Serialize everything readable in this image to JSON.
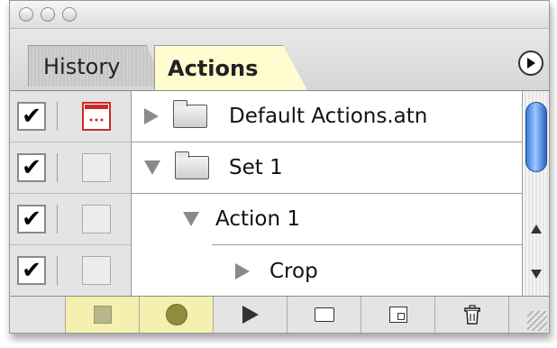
{
  "window": {
    "tabs": [
      {
        "label": "History",
        "active": false
      },
      {
        "label": "Actions",
        "active": true
      }
    ],
    "colors": {
      "active_tab": "#fffccf",
      "scroll_thumb": "#3a78d8",
      "record_button": "#f5efb0"
    }
  },
  "rows": [
    {
      "label": "Default Actions.atn",
      "checked": true,
      "dialog": true,
      "expanded": false,
      "type": "set"
    },
    {
      "label": "Set 1",
      "checked": true,
      "dialog": false,
      "expanded": true,
      "type": "set"
    },
    {
      "label": "Action 1",
      "checked": true,
      "dialog": false,
      "expanded": true,
      "type": "action"
    },
    {
      "label": "Crop",
      "checked": true,
      "dialog": false,
      "expanded": false,
      "type": "command"
    }
  ],
  "check_symbol": "✔",
  "toolbar": {
    "buttons": [
      "stop-icon",
      "record-icon",
      "play-icon",
      "new-set-icon",
      "new-action-icon",
      "trash-icon"
    ]
  }
}
